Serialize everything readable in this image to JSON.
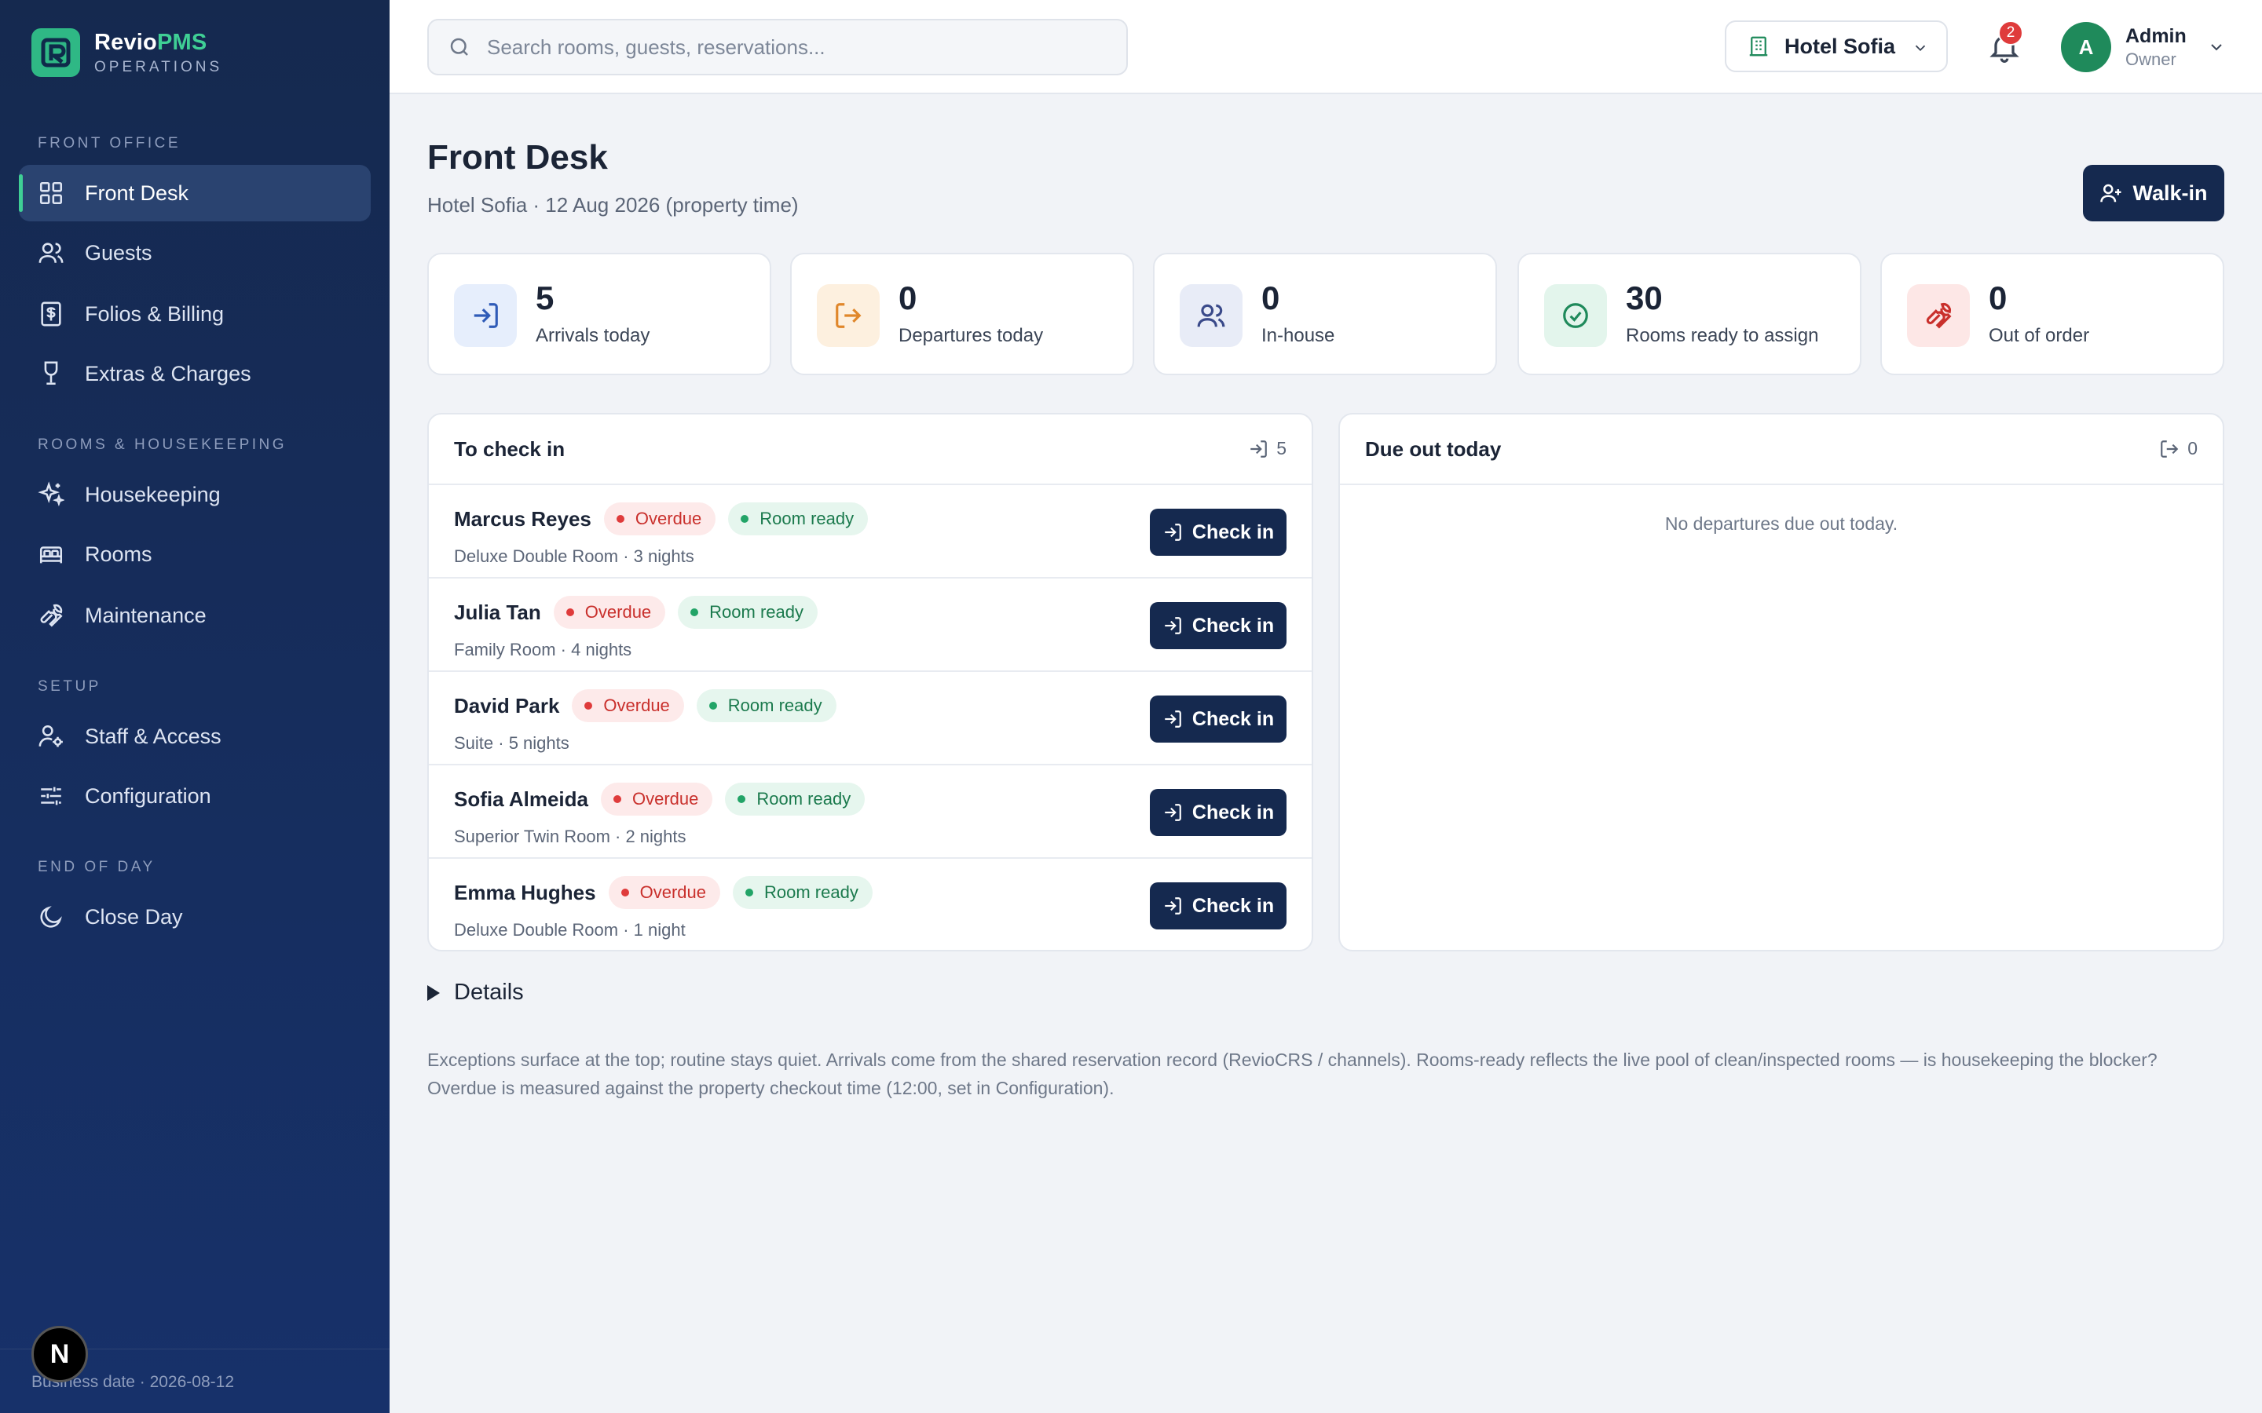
{
  "brand": {
    "name_main": "Revio",
    "name_accent": "PMS",
    "subtitle": "OPERATIONS"
  },
  "sidebar": {
    "sections": [
      {
        "label": "FRONT OFFICE"
      },
      {
        "label": "ROOMS & HOUSEKEEPING"
      },
      {
        "label": "SETUP"
      },
      {
        "label": "END OF DAY"
      }
    ],
    "items": [
      {
        "label": "Front Desk",
        "icon": "grid-icon",
        "active": true
      },
      {
        "label": "Guests",
        "icon": "users-icon"
      },
      {
        "label": "Folios & Billing",
        "icon": "receipt-icon"
      },
      {
        "label": "Extras & Charges",
        "icon": "wine-glass-icon"
      },
      {
        "label": "Housekeeping",
        "icon": "sparkles-icon"
      },
      {
        "label": "Rooms",
        "icon": "bed-icon"
      },
      {
        "label": "Maintenance",
        "icon": "wrench-icon"
      },
      {
        "label": "Staff & Access",
        "icon": "user-gear-icon"
      },
      {
        "label": "Configuration",
        "icon": "sliders-icon"
      },
      {
        "label": "Close Day",
        "icon": "moon-icon"
      }
    ],
    "footer": {
      "business_date": "Business date · 2026-08-12",
      "badge": "N"
    }
  },
  "topbar": {
    "search_placeholder": "Search rooms, guests, reservations...",
    "hotel": "Hotel Sofia",
    "notifications": "2",
    "user": {
      "initial": "A",
      "name": "Admin",
      "role": "Owner"
    }
  },
  "page": {
    "title": "Front Desk",
    "subtitle": "Hotel Sofia · 12 Aug 2026 (property time)",
    "walkin_label": "Walk-in"
  },
  "stats": [
    {
      "value": "5",
      "label": "Arrivals today",
      "icon": "arrow-in-icon",
      "color": "#2f5bb7"
    },
    {
      "value": "0",
      "label": "Departures today",
      "icon": "arrow-out-icon",
      "color": "#e0872b"
    },
    {
      "value": "0",
      "label": "In-house",
      "icon": "users-icon",
      "color": "#3a4a8a"
    },
    {
      "value": "30",
      "label": "Rooms ready to assign",
      "icon": "check-circle-icon",
      "color": "#1f8a5b"
    },
    {
      "value": "0",
      "label": "Out of order",
      "icon": "wrench-icon",
      "color": "#c9302c"
    }
  ],
  "checkin_panel": {
    "title": "To check in",
    "count": "5",
    "button_label": "Check in",
    "rows": [
      {
        "name": "Marcus Reyes",
        "status": "Overdue",
        "room_status": "Room ready",
        "detail": "Deluxe Double Room · 3 nights"
      },
      {
        "name": "Julia Tan",
        "status": "Overdue",
        "room_status": "Room ready",
        "detail": "Family Room · 4 nights"
      },
      {
        "name": "David Park",
        "status": "Overdue",
        "room_status": "Room ready",
        "detail": "Suite · 5 nights"
      },
      {
        "name": "Sofia Almeida",
        "status": "Overdue",
        "room_status": "Room ready",
        "detail": "Superior Twin Room · 2 nights"
      },
      {
        "name": "Emma Hughes",
        "status": "Overdue",
        "room_status": "Room ready",
        "detail": "Deluxe Double Room · 1 night"
      }
    ]
  },
  "dueout_panel": {
    "title": "Due out today",
    "count": "0",
    "empty_text": "No departures due out today."
  },
  "details": {
    "label": "Details",
    "note": "Exceptions surface at the top; routine stays quiet. Arrivals come from the shared reservation record (RevioCRS / channels). Rooms-ready reflects the live pool of clean/inspected rooms — is housekeeping the blocker? Overdue is measured against the property checkout time (12:00, set in Configuration)."
  },
  "colors": {
    "sidebar_bg": "#15294f",
    "accent": "#3fcf95",
    "primary_button": "#15294f",
    "danger": "#df3b3b",
    "success": "#22a467"
  }
}
